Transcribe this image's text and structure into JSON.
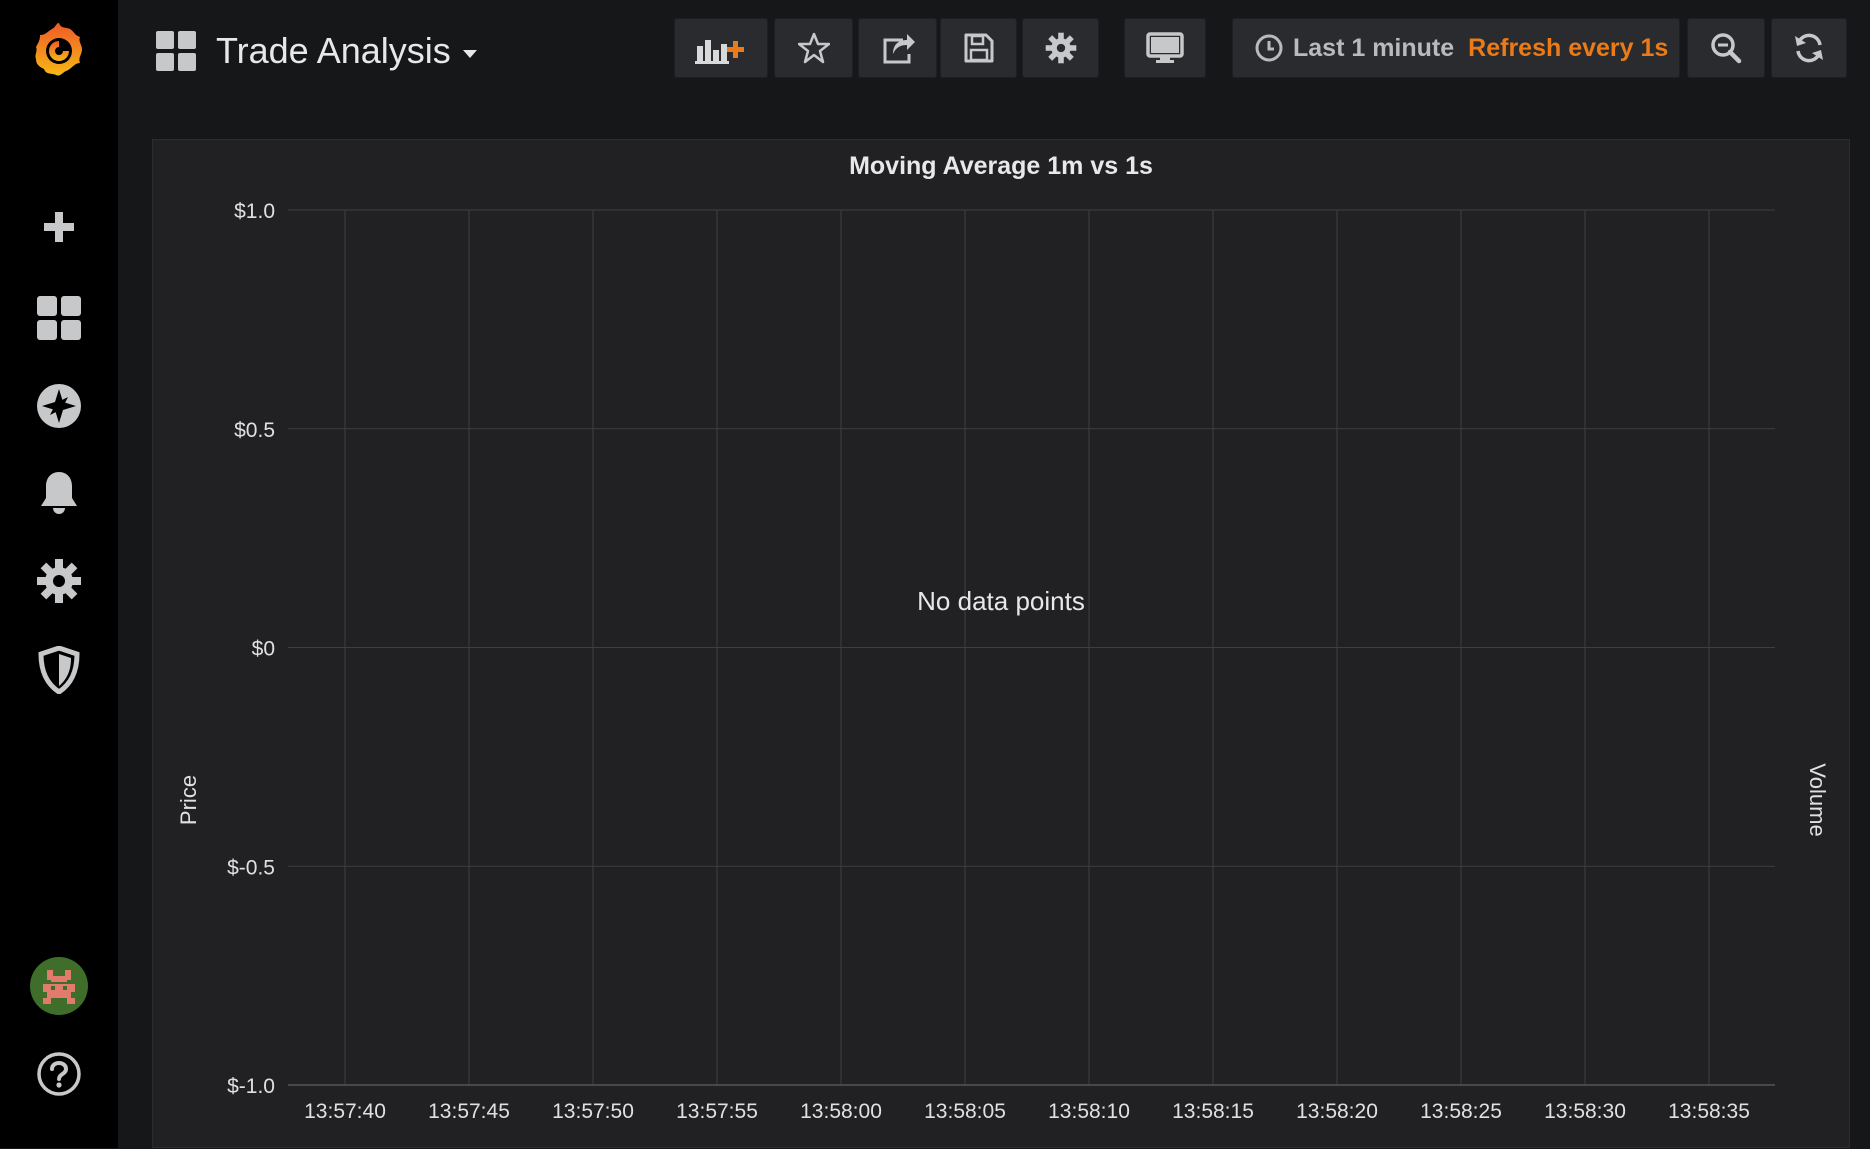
{
  "header": {
    "title": "Trade Analysis",
    "time_range": "Last 1 minute",
    "refresh": "Refresh every 1s"
  },
  "toolbar": {
    "icons": [
      "add-panel-icon",
      "star-icon",
      "share-icon",
      "save-icon",
      "settings-icon",
      "tv-mode-icon",
      "zoom-out-icon",
      "refresh-icon"
    ]
  },
  "sidebar": {
    "icons": [
      "grafana-logo-icon",
      "plus-icon",
      "dashboards-icon",
      "explore-compass-icon",
      "bell-icon",
      "gear-icon",
      "shield-icon",
      "avatar",
      "help-icon"
    ]
  },
  "colors": {
    "accent_orange": "#eb7b18",
    "panel_bg": "#212124",
    "page_bg": "#161719",
    "sidebar_bg": "#000000"
  },
  "panel": {
    "title": "Moving Average 1m vs 1s",
    "ylabel_left": "Price",
    "ylabel_right": "Volume",
    "no_data": "No data points"
  },
  "chart_data": {
    "type": "line",
    "title": "Moving Average 1m vs 1s",
    "xlabel": "",
    "ylabel": "Price",
    "y2label": "Volume",
    "ylim": [
      -1.0,
      1.0
    ],
    "y_ticks": [
      1.0,
      0.5,
      0,
      -0.5,
      -1.0
    ],
    "y_tick_labels": [
      "$1.0",
      "$0.5",
      "$0",
      "$-0.5",
      "$-1.0"
    ],
    "x_tick_labels": [
      "13:57:40",
      "13:57:45",
      "13:57:50",
      "13:57:55",
      "13:58:00",
      "13:58:05",
      "13:58:10",
      "13:58:15",
      "13:58:20",
      "13:58:25",
      "13:58:30",
      "13:58:35"
    ],
    "series": [],
    "grid": true
  }
}
